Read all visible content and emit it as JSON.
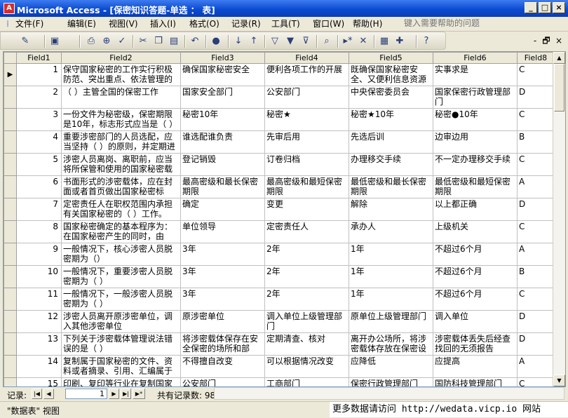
{
  "window": {
    "title": "Microsoft Access - [保密知识答题-单选 ： 表]",
    "icon": "access-key-icon",
    "min_label": "_",
    "max_label": "□",
    "close_label": "×"
  },
  "menu": {
    "items": [
      "文件(F)",
      "编辑(E)",
      "视图(V)",
      "插入(I)",
      "格式(O)",
      "记录(R)",
      "工具(T)",
      "窗口(W)",
      "帮助(H)"
    ],
    "help_placeholder": "键入需要帮助的问题",
    "mdi_min": "-",
    "mdi_restore": "🗗",
    "mdi_close": "×"
  },
  "toolbar": {
    "icons": [
      "design-view-icon",
      "save-icon",
      "print-icon",
      "print-preview-icon",
      "spelling-icon",
      "cut-icon",
      "copy-icon",
      "paste-icon",
      "undo-icon",
      "insert-hyperlink-icon",
      "sort-ascending-icon",
      "sort-descending-icon",
      "filter-by-selection-icon",
      "filter-by-form-icon",
      "apply-filter-icon",
      "find-icon",
      "new-record-icon",
      "delete-record-icon",
      "database-window-icon",
      "new-object-icon",
      "help-icon"
    ]
  },
  "grid": {
    "columns": [
      "Field1",
      "Field2",
      "Field3",
      "Field4",
      "Field5",
      "Field6",
      "Field8"
    ],
    "rows": [
      [
        "1",
        "保守国家秘密的工作实行积极防范、突出重点、依法管理的",
        "确保国家秘密安全",
        "便利各项工作的开展",
        "既确保国家秘密安全、又便利信息资源",
        "实事求是",
        "C"
      ],
      [
        "2",
        "（ ）主管全国的保密工作",
        "国家安全部门",
        "公安部门",
        "中央保密委员会",
        "国家保密行政管理部门",
        "D"
      ],
      [
        "3",
        "一份文件为秘密级，保密期限是10年，标志形式应当是（ ）",
        "秘密10年",
        "秘密★",
        "秘密★10年",
        "秘密●10年",
        "C"
      ],
      [
        "4",
        "重要涉密部门的人员选配，应当坚持（ ）的原则，并定期进",
        "谁选配谁负责",
        "先审后用",
        "先选后训",
        "边审边用",
        "B"
      ],
      [
        "5",
        "涉密人员离岗、离职前，应当将所保管和使用的国家秘密载",
        "登记销毁",
        "订卷归档",
        "办理移交手续",
        "不一定办理移交手续",
        "C"
      ],
      [
        "6",
        "书面形式的涉密载体，应在封面或者首页做出国家秘密标",
        "最高密级和最长保密期限",
        "最高密级和最短保密期限",
        "最低密级和最长保密期限",
        "最低密级和最短保密期限",
        "A"
      ],
      [
        "7",
        "定密责任人在职权范围内承担有关国家秘密的（ ）工作。",
        "确定",
        "变更",
        "解除",
        "以上都正确",
        "D"
      ],
      [
        "8",
        "国家秘密确定的基本程序为：在国家秘密产生的同时，由",
        "单位领导",
        "定密责任人",
        "承办人",
        "上级机关",
        "C"
      ],
      [
        "9",
        "一般情况下，核心涉密人员脱密期为（）",
        "3年",
        "2年",
        "1年",
        "不超过6个月",
        "A"
      ],
      [
        "10",
        "一般情况下，重要涉密人员脱密期为（ ）",
        "3年",
        "2年",
        "1年",
        "不超过6个月",
        "B"
      ],
      [
        "11",
        "一般情况下，一般涉密人员脱密期为（ ）",
        "3年",
        "2年",
        "1年",
        "不超过6个月",
        "C"
      ],
      [
        "12",
        "涉密人员离开原涉密单位，调入其他涉密单位",
        "原涉密单位",
        "调入单位上级管理部门",
        "原单位上级管理部门",
        "调入单位",
        "D"
      ],
      [
        "13",
        "下列关于涉密载体管理说法错误的是（ ）",
        "将涉密载体保存在安全保密的场所和部",
        "定期清查、核对",
        "离开办公场所，将涉密载体存放在保密设",
        "涉密载体丢失后经查找回的无须报告",
        "D"
      ],
      [
        "14",
        "复制属于国家秘密的文件、资料或者摘录、引用、汇编属于",
        "不得擅自改变",
        "可以根据情况改变",
        "应降低",
        "应提高",
        "A"
      ],
      [
        "15",
        "印刷、复印等行业在复制国家秘密载体方面，接受县级以上",
        "公安部门",
        "工商部门",
        "保密行政管理部门",
        "国防科技管理部门",
        "C"
      ]
    ],
    "current_record_marker": "▶"
  },
  "navigation": {
    "label": "记录:",
    "current": "1",
    "first": "|◀",
    "prev": "◀",
    "next": "▶",
    "last": "▶|",
    "new": "▶*",
    "count_text": "共有记录数: 98"
  },
  "status": {
    "view_text": "\"数据表\" 视图",
    "watermark": "更多数据请访问 http://wedata.vicp.io 网站"
  }
}
